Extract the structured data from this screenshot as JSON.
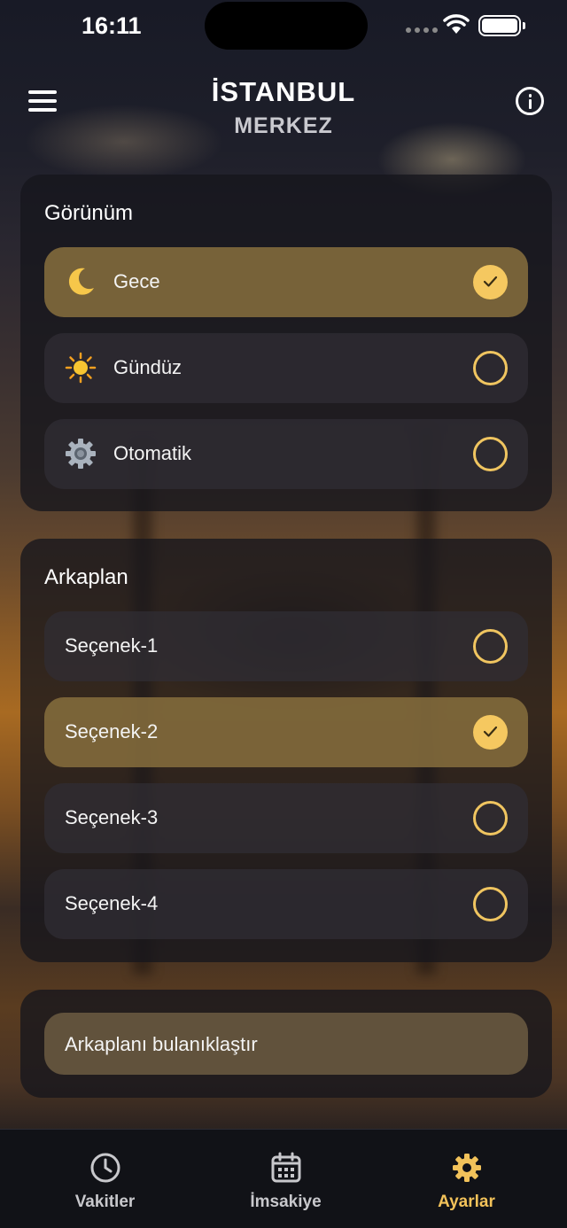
{
  "status_bar": {
    "time": "16:11"
  },
  "header": {
    "city": "İSTANBUL",
    "district": "MERKEZ"
  },
  "appearance": {
    "title": "Görünüm",
    "options": [
      {
        "label": "Gece",
        "icon": "crescent-moon-icon",
        "selected": true
      },
      {
        "label": "Gündüz",
        "icon": "sun-icon",
        "selected": false
      },
      {
        "label": "Otomatik",
        "icon": "gear-icon",
        "selected": false
      }
    ]
  },
  "background": {
    "title": "Arkaplan",
    "options": [
      {
        "label": "Seçenek-1",
        "selected": false
      },
      {
        "label": "Seçenek-2",
        "selected": true
      },
      {
        "label": "Seçenek-3",
        "selected": false
      },
      {
        "label": "Seçenek-4",
        "selected": false
      }
    ]
  },
  "blur": {
    "label": "Arkaplanı bulanıklaştır"
  },
  "tabs": [
    {
      "label": "Vakitler",
      "icon": "clock-icon",
      "active": false
    },
    {
      "label": "İmsakiye",
      "icon": "calendar-icon",
      "active": false
    },
    {
      "label": "Ayarlar",
      "icon": "gear-icon",
      "active": true
    }
  ],
  "colors": {
    "accent": "#f5c860",
    "tab_active": "#f2c25a",
    "selected_row": "#846c3c"
  }
}
